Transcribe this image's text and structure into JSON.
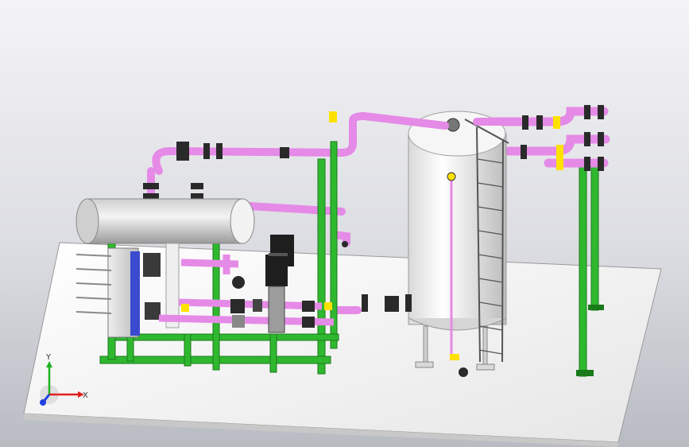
{
  "viewport": {
    "background_top": "#f4f4f6",
    "background_bottom": "#b9bbc3"
  },
  "colors": {
    "pipe": "#e58ae6",
    "pipe_dark": "#b860b9",
    "frame": "#2fb82f",
    "frame_dark": "#197a19",
    "vessel": "#ececec",
    "vessel_shade": "#c9c9c9",
    "drum": "#d8d8d8",
    "floor": "#fafafa",
    "pump_motor": "#1e1e1e",
    "flange": "#ffe100",
    "valve": "#2a2a2a",
    "hx_plate": "#3a4bd0"
  },
  "model": {
    "components": [
      "base-plate",
      "horizontal-drum",
      "plate-heat-exchanger",
      "vertical-tank",
      "vertical-pumps",
      "pipe-rack",
      "ladder"
    ]
  },
  "triad": {
    "x_label": "X",
    "y_label": "Y",
    "x_color": "#e02020",
    "y_color": "#20b020",
    "z_color": "#2040e0"
  }
}
